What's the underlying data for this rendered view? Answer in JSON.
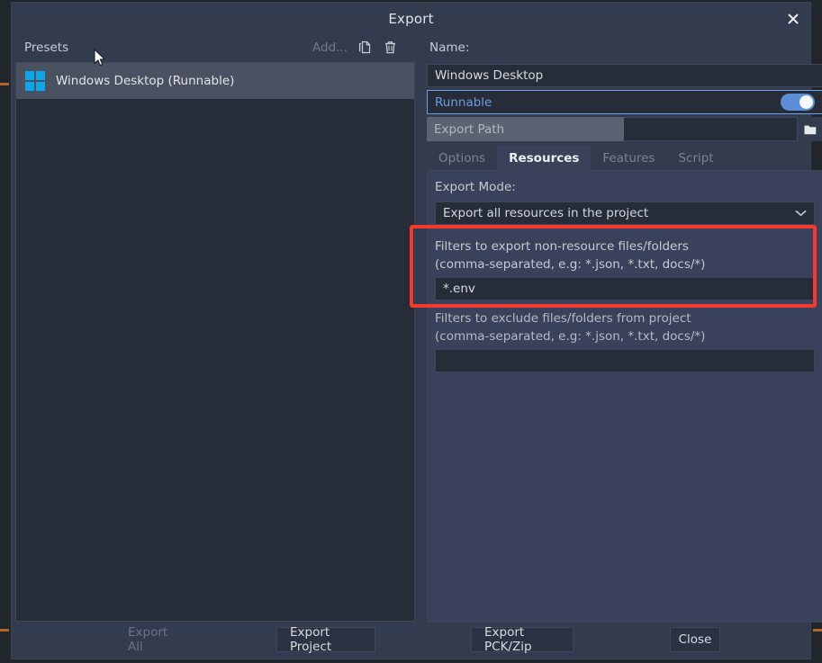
{
  "window": {
    "title": "Export",
    "close_icon": "close-icon"
  },
  "presets": {
    "header_label": "Presets",
    "add_label": "Add...",
    "duplicate_icon": "duplicate-icon",
    "delete_icon": "trash-icon",
    "items": [
      {
        "label": "Windows Desktop (Runnable)",
        "icon": "windows-logo-icon",
        "selected": true
      }
    ]
  },
  "details": {
    "name_label": "Name:",
    "name_value": "Windows Desktop",
    "runnable_label": "Runnable",
    "runnable_enabled": true,
    "export_path_label": "Export Path",
    "export_path_value": "",
    "browse_icon": "folder-icon"
  },
  "tabs": [
    {
      "label": "Options",
      "active": false
    },
    {
      "label": "Resources",
      "active": true
    },
    {
      "label": "Features",
      "active": false
    },
    {
      "label": "Script",
      "active": false
    }
  ],
  "resources": {
    "export_mode_label": "Export Mode:",
    "export_mode_value": "Export all resources in the project",
    "export_mode_chevron": "chevron-down-icon",
    "include_filter_label_line1": "Filters to export non-resource files/folders",
    "include_filter_label_line2": "(comma-separated, e.g: *.json, *.txt, docs/*)",
    "include_filter_value": "*.env",
    "exclude_filter_label_line1": "Filters to exclude files/folders from project",
    "exclude_filter_label_line2": "(comma-separated, e.g: *.json, *.txt, docs/*)",
    "exclude_filter_value": ""
  },
  "footer": {
    "export_all_label": "Export All",
    "export_all_disabled": true,
    "export_project_label": "Export Project",
    "export_pck_zip_label": "Export PCK/Zip",
    "close_label": "Close"
  },
  "annotation": {
    "highlight_color": "#f4392f"
  },
  "colors": {
    "accent_blue": "#5d8fd6",
    "dialog_bg": "#333b4f",
    "panel_bg": "#39425a",
    "input_bg": "#262c38",
    "windows_logo": "#0ea5e9"
  }
}
